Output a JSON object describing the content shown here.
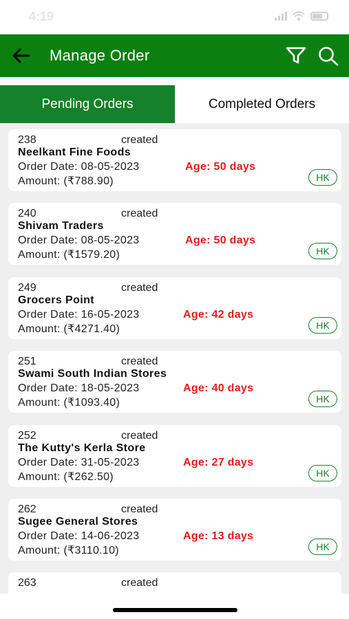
{
  "status_bar": {
    "time": "4:19"
  },
  "header": {
    "title": "Manage Order",
    "back_icon": "arrow-left-icon",
    "filter_icon": "filter-funnel-icon",
    "search_icon": "magnifier-search-icon",
    "color": "#0b8010"
  },
  "tabs": [
    {
      "label": "Pending Orders",
      "active": true
    },
    {
      "label": "Completed Orders",
      "active": false
    }
  ],
  "orders": [
    {
      "id": "238",
      "status": "created",
      "name": "Neelkant Fine Foods",
      "order_date": "Order Date: 08-05-2023",
      "age": "Age: 50 days",
      "amount": "Amount:  (₹788.90)",
      "badge": "HK"
    },
    {
      "id": "240",
      "status": "created",
      "name": "Shivam Traders",
      "order_date": "Order Date: 08-05-2023",
      "age": "Age: 50 days",
      "amount": "Amount:  (₹1579.20)",
      "badge": "HK"
    },
    {
      "id": "249",
      "status": "created",
      "name": "Grocers Point",
      "order_date": "Order Date: 16-05-2023",
      "age": "Age: 42 days",
      "amount": "Amount:  (₹4271.40)",
      "badge": "HK"
    },
    {
      "id": "251",
      "status": "created",
      "name": "Swami South Indian Stores",
      "order_date": "Order Date: 18-05-2023",
      "age": "Age: 40 days",
      "amount": "Amount:  (₹1093.40)",
      "badge": "HK"
    },
    {
      "id": "252",
      "status": "created",
      "name": "The Kutty's Kerla Store",
      "order_date": "Order Date: 31-05-2023",
      "age": "Age: 27 days",
      "amount": "Amount:  (₹262.50)",
      "badge": "HK"
    },
    {
      "id": "262",
      "status": "created",
      "name": "Sugee General Stores",
      "order_date": "Order Date: 14-06-2023",
      "age": "Age: 13 days",
      "amount": "Amount:  (₹3110.10)",
      "badge": "HK"
    },
    {
      "id": "263",
      "status": "created",
      "name": "",
      "order_date": "",
      "age": "",
      "amount": "",
      "badge": ""
    }
  ],
  "colors": {
    "accent": "#15812a",
    "age_text": "#e51c1c",
    "list_bg": "#efefef"
  }
}
